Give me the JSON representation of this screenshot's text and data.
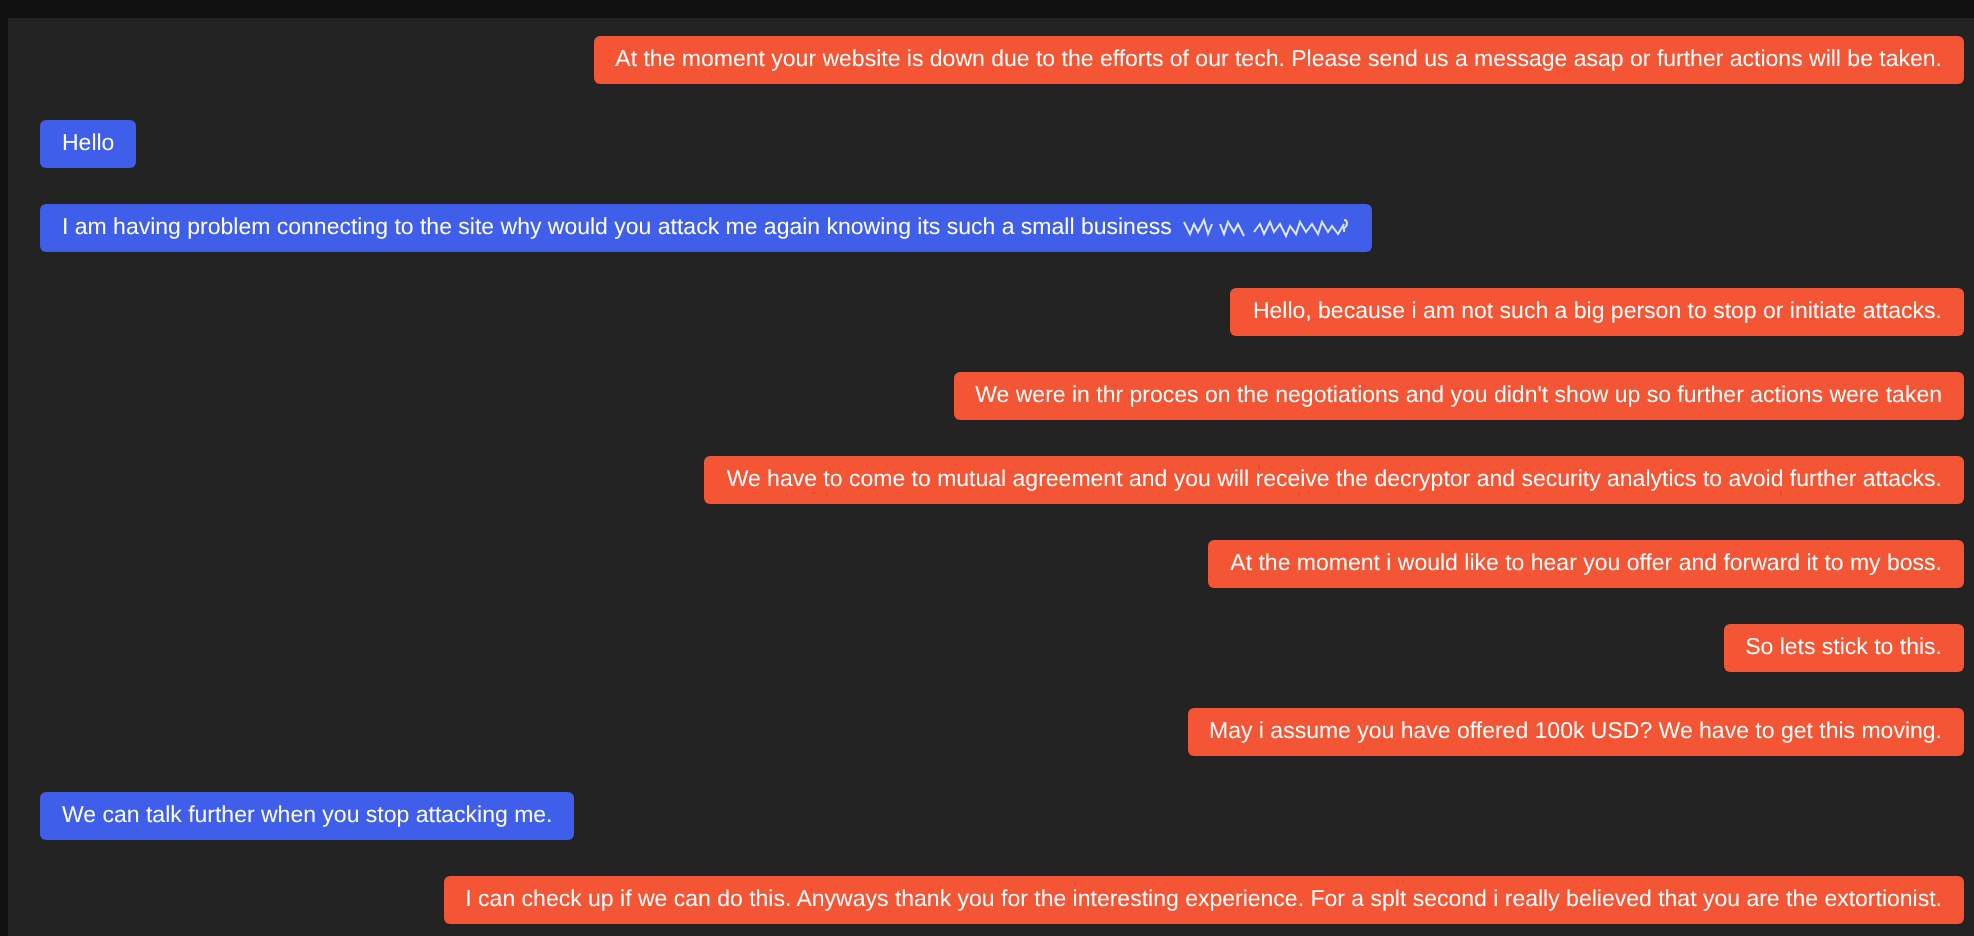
{
  "messages": [
    {
      "kind": "outgoing",
      "text": "At the moment your website is down due to the efforts of our tech. Please send us a message asap or further actions will be taken.",
      "garbled_tail": false
    },
    {
      "kind": "incoming",
      "text": "Hello",
      "garbled_tail": false
    },
    {
      "kind": "incoming",
      "text": "I am having problem connecting to the site why would you attack me again knowing its such a small business",
      "garbled_tail": true
    },
    {
      "kind": "outgoing",
      "text": "Hello, because i am not such a big person to stop or initiate attacks.",
      "garbled_tail": false
    },
    {
      "kind": "outgoing",
      "text": "We were in thr proces on the negotiations and you didn't show up so further actions were taken",
      "garbled_tail": false
    },
    {
      "kind": "outgoing",
      "text": "We have to come to mutual agreement and you will receive the decryptor and security analytics to avoid further attacks.",
      "garbled_tail": false
    },
    {
      "kind": "outgoing",
      "text": "At the moment i would like to hear you offer and forward it to my boss.",
      "garbled_tail": false
    },
    {
      "kind": "outgoing",
      "text": "So lets stick to this.",
      "garbled_tail": false
    },
    {
      "kind": "outgoing",
      "text": "May i assume you have offered 100k USD? We have to get this moving.",
      "garbled_tail": false
    },
    {
      "kind": "incoming",
      "text": "We can talk further when you stop attacking me.",
      "garbled_tail": false
    },
    {
      "kind": "outgoing",
      "text": "I can check up if we can do this. Anyways thank you for the interesting experience. For a splt second i really believed that you are the extortionist.",
      "garbled_tail": false
    }
  ]
}
